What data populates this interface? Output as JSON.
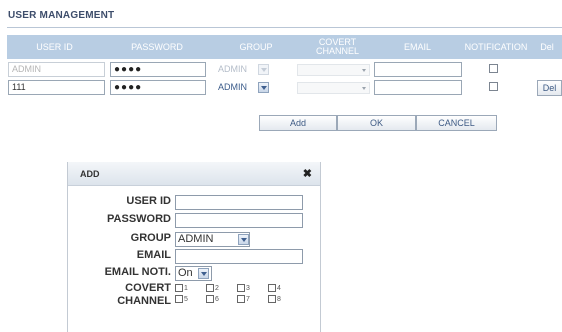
{
  "page": {
    "title": "USER MANAGEMENT"
  },
  "table": {
    "headers": {
      "user_id": "USER ID",
      "password": "PASSWORD",
      "group": "GROUP",
      "covert_channel": "COVERT\nCHANNEL",
      "email": "EMAIL",
      "notification": "NOTIFICATION",
      "del": "Del"
    },
    "rows": [
      {
        "user_id": "ADMIN",
        "password": "●●●●",
        "group": "ADMIN",
        "email": "",
        "notification_checked": false,
        "editable": false
      },
      {
        "user_id": "111",
        "password": "●●●●",
        "group": "ADMIN",
        "email": "",
        "notification_checked": false,
        "editable": true,
        "del_label": "Del"
      }
    ]
  },
  "actions": {
    "add": "Add",
    "ok": "OK",
    "cancel": "CANCEL"
  },
  "add_dialog": {
    "title": "ADD",
    "close_glyph": "✖",
    "labels": {
      "user_id": "USER ID",
      "password": "PASSWORD",
      "group": "GROUP",
      "email": "EMAIL",
      "email_noti": "EMAIL NOTI.",
      "covert": "COVERT",
      "channel": "CHANNEL"
    },
    "values": {
      "user_id": "",
      "password": "",
      "group": "ADMIN",
      "email": "",
      "email_noti": "On"
    },
    "covert_channels": [
      "1",
      "2",
      "3",
      "4",
      "5",
      "6",
      "7",
      "8"
    ]
  },
  "colors": {
    "header_bg": "#b8cde3",
    "title_text": "#3d4d6b",
    "accent_text": "#3d5a84"
  },
  "icons": {
    "dropdown": "chevron-down-icon",
    "close": "close-icon"
  }
}
